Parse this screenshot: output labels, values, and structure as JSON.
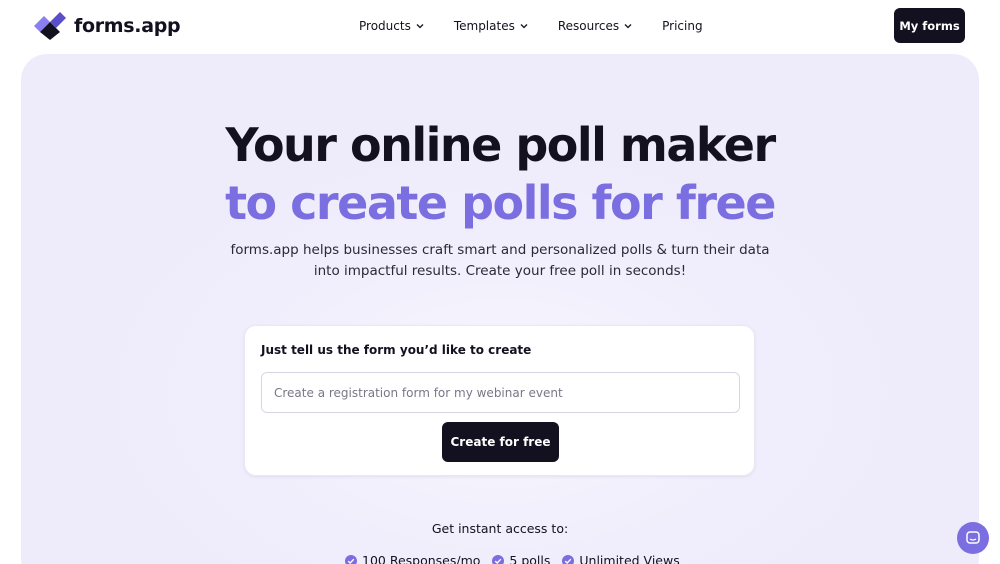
{
  "brand": {
    "name": "forms.app",
    "accent": "#7b6ee0",
    "dark": "#13111f"
  },
  "nav": {
    "items": [
      {
        "label": "Products",
        "dropdown": true
      },
      {
        "label": "Templates",
        "dropdown": true
      },
      {
        "label": "Resources",
        "dropdown": true
      },
      {
        "label": "Pricing",
        "dropdown": false
      }
    ],
    "my_forms_label": "My forms"
  },
  "hero": {
    "title_line1": "Your online poll maker",
    "title_line2": "to create polls for free",
    "subtitle": "forms.app helps businesses craft smart and personalized polls & turn their data into impactful results. Create your free poll in seconds!"
  },
  "card": {
    "label": "Just tell us the form you’d like to create",
    "input_placeholder": "Create a registration form for my webinar event",
    "input_value": "",
    "button_label": "Create for free"
  },
  "access": {
    "title": "Get instant access to:",
    "features": [
      "100 Responses/mo",
      "5 polls",
      "Unlimited Views"
    ]
  },
  "icons": {
    "logo": "forms-app-logo-icon",
    "chevron": "chevron-down-icon",
    "check": "check-circle-icon",
    "chat": "chat-icon"
  }
}
